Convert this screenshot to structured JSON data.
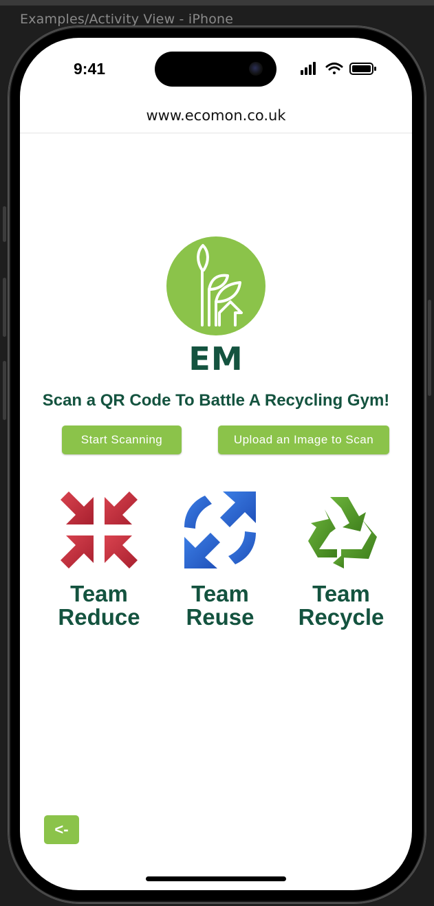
{
  "window": {
    "title": "Examples/Activity View - iPhone"
  },
  "status_bar": {
    "time": "9:41"
  },
  "browser": {
    "url": "www.ecomon.co.uk"
  },
  "logo": {
    "text": "EM",
    "icon": "plant-house-icon"
  },
  "main": {
    "headline": "Scan a QR Code To Battle A Recycling Gym!",
    "start_scanning_label": "Start Scanning",
    "upload_label": "Upload an Image to Scan"
  },
  "teams": [
    {
      "line1": "Team",
      "line2": "Reduce",
      "icon": "arrows-inward-icon",
      "color": "#c7323f"
    },
    {
      "line1": "Team",
      "line2": "Reuse",
      "icon": "arrows-cycle-icon",
      "color": "#2f6fd6"
    },
    {
      "line1": "Team",
      "line2": "Recycle",
      "icon": "recycle-icon",
      "color": "#4f9a2a"
    }
  ],
  "back": {
    "label": "<-"
  },
  "colors": {
    "accent": "#8bc34a",
    "brand_dark": "#14533f"
  }
}
